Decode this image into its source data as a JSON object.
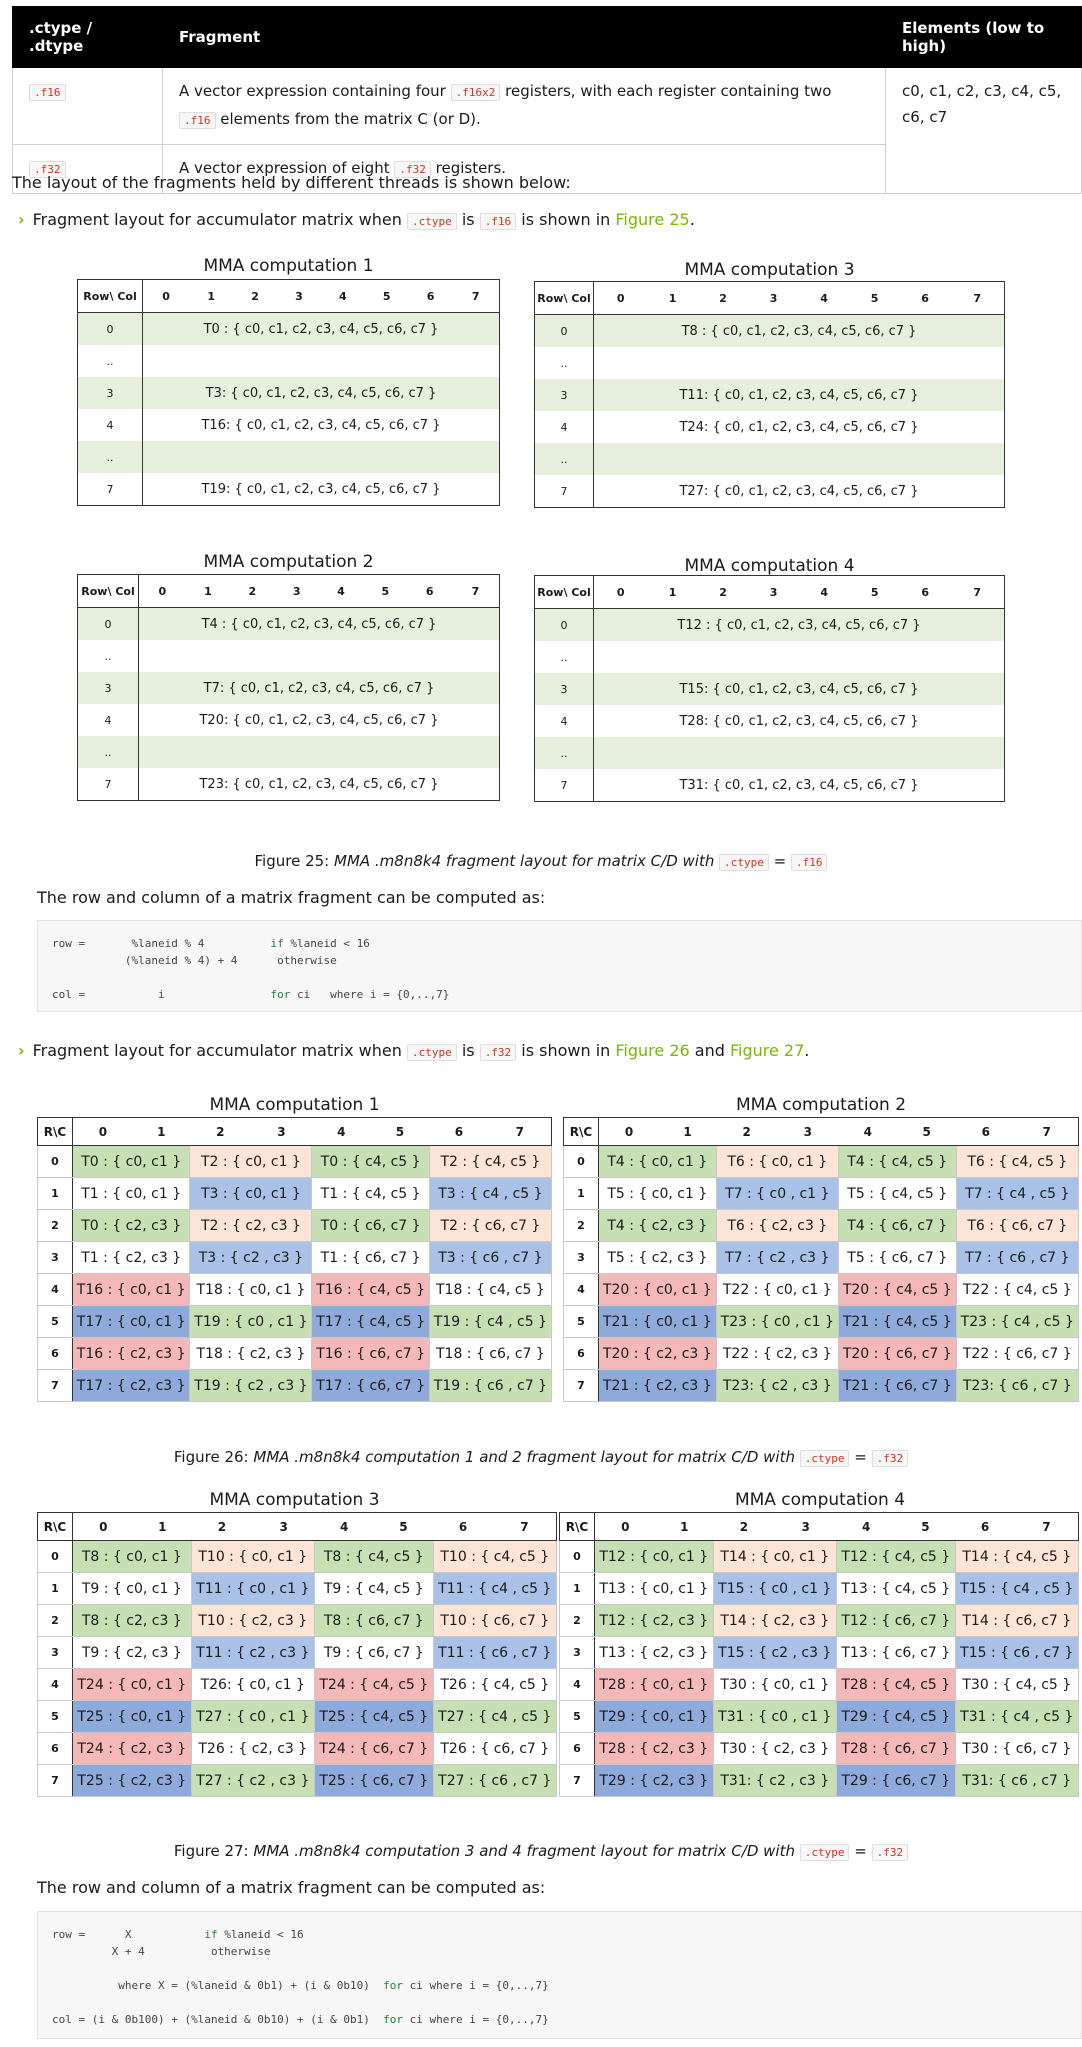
{
  "ctype_table": {
    "headers": [
      ".ctype / .dtype",
      "Fragment",
      "Elements (low to high)"
    ],
    "row1": {
      "type": ".f16",
      "desc_a": "A vector expression containing four ",
      "desc_code": ".f16x2",
      "desc_b": " registers, with each register containing two ",
      "desc_code2": ".f16",
      "desc_c": " elements from the matrix C (or D).",
      "elements": "c0, c1, c2, c3, c4, c5, c6, c7"
    },
    "row2": {
      "type": ".f32",
      "desc_a": "A vector expression of eight ",
      "desc_code": ".f32",
      "desc_b": " registers."
    }
  },
  "intro_text": "The layout of the fragments held by different threads is shown below:",
  "bullet1": {
    "a": "Fragment layout for accumulator matrix when ",
    "code1": ".ctype",
    "b": " is ",
    "code2": ".f16",
    "c": " is shown in ",
    "link1": "Figure 25",
    "d": "."
  },
  "mma_small": {
    "cols": [
      "Row\\ Col",
      "0",
      "1",
      "2",
      "3",
      "4",
      "5",
      "6",
      "7"
    ],
    "comp1": {
      "title": "MMA computation 1",
      "rows": [
        [
          "0",
          "T0 : { c0, c1, c2, c3, c4, c5, c6, c7 }"
        ],
        [
          "..",
          ""
        ],
        [
          "3",
          "T3: { c0, c1, c2, c3, c4, c5, c6, c7 }"
        ],
        [
          "4",
          "T16: { c0, c1, c2, c3, c4, c5, c6, c7 }"
        ],
        [
          "..",
          ""
        ],
        [
          "7",
          "T19: { c0, c1, c2, c3, c4, c5, c6, c7 }"
        ]
      ]
    },
    "comp2": {
      "title": "MMA computation 2",
      "rows": [
        [
          "0",
          "T4 : { c0, c1, c2, c3, c4, c5, c6, c7 }"
        ],
        [
          "..",
          ""
        ],
        [
          "3",
          "T7: { c0, c1, c2, c3, c4, c5, c6, c7 }"
        ],
        [
          "4",
          "T20: { c0, c1, c2, c3, c4, c5, c6, c7 }"
        ],
        [
          "..",
          ""
        ],
        [
          "7",
          "T23: { c0, c1, c2, c3, c4, c5, c6, c7 }"
        ]
      ]
    },
    "comp3": {
      "title": "MMA computation 3",
      "rows": [
        [
          "0",
          "T8 : { c0, c1, c2, c3, c4, c5, c6, c7 }"
        ],
        [
          "..",
          ""
        ],
        [
          "3",
          "T11: { c0, c1, c2, c3, c4, c5, c6, c7 }"
        ],
        [
          "4",
          "T24: { c0, c1, c2, c3, c4, c5, c6, c7 }"
        ],
        [
          "..",
          ""
        ],
        [
          "7",
          "T27: { c0, c1, c2, c3, c4, c5, c6, c7 }"
        ]
      ]
    },
    "comp4": {
      "title": "MMA computation 4",
      "rows": [
        [
          "0",
          "T12 : { c0, c1, c2, c3, c4, c5, c6, c7 }"
        ],
        [
          "..",
          ""
        ],
        [
          "3",
          "T15: { c0, c1, c2, c3, c4, c5, c6, c7 }"
        ],
        [
          "4",
          "T28: { c0, c1, c2, c3, c4, c5, c6, c7 }"
        ],
        [
          "..",
          ""
        ],
        [
          "7",
          "T31: { c0, c1, c2, c3, c4, c5, c6, c7 }"
        ]
      ]
    }
  },
  "fig25": {
    "a": "Figure 25: ",
    "b": "MMA .m8n8k4 fragment layout for matrix C/D with ",
    "code1": ".ctype",
    "eq": " = ",
    "code2": ".f16"
  },
  "rowcol_text1": "The row and column of a matrix fragment can be computed as:",
  "code1": {
    "l1a": "row =       %laneid % 4          ",
    "l1kw": "if",
    "l1b": " %laneid < 16",
    "l2": "           (%laneid % 4) + 4      otherwise",
    "l3a": "col =           i                ",
    "l3kw": "for",
    "l3b": " ci   where i = {0,..,7}"
  },
  "bullet2": {
    "a": "Fragment layout for accumulator matrix when ",
    "code1": ".ctype",
    "b": " is ",
    "code2": ".f32",
    "c": " is shown in ",
    "link1": "Figure 26",
    "d": " and ",
    "link2": "Figure 27",
    "e": "."
  },
  "mma_big": {
    "cols": [
      "R\\C",
      "0",
      "1",
      "2",
      "3",
      "4",
      "5",
      "6",
      "7"
    ],
    "comp1": {
      "title": "MMA computation 1",
      "rows": [
        [
          "0",
          "T0 : { c0, c1 }",
          "T2 : { c0, c1 }",
          "T0 : { c4, c5 }",
          "T2 : { c4, c5 }"
        ],
        [
          "1",
          "T1 : { c0, c1 }",
          "T3 : { c0, c1 }",
          "T1 : { c4, c5 }",
          "T3 : { c4 , c5 }"
        ],
        [
          "2",
          "T0 : { c2, c3 }",
          "T2 : { c2, c3 }",
          "T0 : { c6, c7 }",
          "T2 : { c6, c7 }"
        ],
        [
          "3",
          "T1 : { c2, c3 }",
          "T3 : { c2 , c3 }",
          "T1 : { c6, c7 }",
          "T3 : { c6 , c7 }"
        ],
        [
          "4",
          "T16 : { c0, c1 }",
          "T18 : { c0, c1 }",
          "T16 : { c4, c5 }",
          "T18 : { c4, c5 }"
        ],
        [
          "5",
          "T17 : { c0, c1 }",
          "T19 : { c0 , c1 }",
          "T17 : { c4, c5 }",
          "T19 : { c4 , c5 }"
        ],
        [
          "6",
          "T16 : { c2, c3 }",
          "T18 : { c2, c3 }",
          "T16 : { c6, c7 }",
          "T18 : { c6, c7 }"
        ],
        [
          "7",
          "T17 : { c2, c3 }",
          "T19 : { c2 , c3 }",
          "T17 : { c6, c7 }",
          "T19 : { c6 , c7 }"
        ]
      ]
    },
    "comp2": {
      "title": "MMA computation 2",
      "rows": [
        [
          "0",
          "T4 : { c0, c1 }",
          "T6 : { c0, c1 }",
          "T4 : { c4, c5 }",
          "T6 : { c4, c5 }"
        ],
        [
          "1",
          "T5 : { c0, c1 }",
          "T7 : { c0 , c1 }",
          "T5 : { c4, c5 }",
          "T7 : { c4 , c5 }"
        ],
        [
          "2",
          "T4 : { c2, c3 }",
          "T6 : { c2, c3 }",
          "T4 : { c6, c7 }",
          "T6 : { c6, c7 }"
        ],
        [
          "3",
          "T5 : { c2, c3 }",
          "T7 : { c2 , c3 }",
          "T5 : { c6, c7 }",
          "T7 : { c6 , c7 }"
        ],
        [
          "4",
          "T20 : { c0, c1 }",
          "T22 : { c0, c1 }",
          "T20 : { c4, c5 }",
          "T22 : { c4, c5 }"
        ],
        [
          "5",
          "T21 : { c0, c1 }",
          "T23 : { c0 , c1 }",
          "T21 : { c4, c5 }",
          "T23 : { c4 , c5 }"
        ],
        [
          "6",
          "T20 : { c2, c3 }",
          "T22 : { c2, c3 }",
          "T20 : { c6, c7 }",
          "T22 : { c6, c7 }"
        ],
        [
          "7",
          "T21 : { c2, c3 }",
          "T23: { c2 , c3 }",
          "T21 : { c6, c7 }",
          "T23: { c6 , c7 }"
        ]
      ]
    },
    "comp3": {
      "title": "MMA computation 3",
      "rows": [
        [
          "0",
          "T8 : { c0, c1 }",
          "T10 : { c0, c1 }",
          "T8 : { c4, c5 }",
          "T10 : { c4, c5 }"
        ],
        [
          "1",
          "T9 : { c0, c1 }",
          "T11 : { c0 , c1 }",
          "T9 : { c4, c5 }",
          "T11 : { c4 , c5 }"
        ],
        [
          "2",
          "T8 : { c2, c3 }",
          "T10 : { c2, c3 }",
          "T8 : { c6, c7 }",
          "T10 : { c6, c7 }"
        ],
        [
          "3",
          "T9 : { c2, c3 }",
          "T11 : { c2 , c3 }",
          "T9 : { c6, c7 }",
          "T11 : { c6 , c7 }"
        ],
        [
          "4",
          "T24 : { c0, c1 }",
          "T26: { c0, c1 }",
          "T24 : { c4, c5 }",
          "T26 : { c4, c5 }"
        ],
        [
          "5",
          "T25 : { c0, c1 }",
          "T27 : { c0 , c1 }",
          "T25 : { c4, c5 }",
          "T27 : { c4 , c5 }"
        ],
        [
          "6",
          "T24 : { c2, c3 }",
          "T26 : { c2, c3 }",
          "T24 : { c6, c7 }",
          "T26 : { c6, c7 }"
        ],
        [
          "7",
          "T25 : { c2, c3 }",
          "T27 : { c2 , c3 }",
          "T25 : { c6, c7 }",
          "T27 : { c6 , c7 }"
        ]
      ]
    },
    "comp4": {
      "title": "MMA computation 4",
      "rows": [
        [
          "0",
          "T12 : { c0, c1 }",
          "T14 : { c0, c1 }",
          "T12 : { c4, c5 }",
          "T14 : { c4, c5 }"
        ],
        [
          "1",
          "T13 : { c0, c1 }",
          "T15 : { c0 , c1 }",
          "T13 : { c4, c5 }",
          "T15 : { c4 , c5 }"
        ],
        [
          "2",
          "T12 : { c2, c3 }",
          "T14 : { c2, c3 }",
          "T12 : { c6, c7 }",
          "T14 : { c6, c7 }"
        ],
        [
          "3",
          "T13 : { c2, c3 }",
          "T15 : { c2 , c3 }",
          "T13 : { c6, c7 }",
          "T15 : { c6 , c7 }"
        ],
        [
          "4",
          "T28 : { c0, c1 }",
          "T30 : { c0, c1 }",
          "T28 : { c4, c5 }",
          "T30 : { c4, c5 }"
        ],
        [
          "5",
          "T29 : { c0, c1 }",
          "T31 : { c0 , c1 }",
          "T29 : { c4, c5 }",
          "T31 : { c4 , c5 }"
        ],
        [
          "6",
          "T28 : { c2, c3 }",
          "T30 : { c2, c3 }",
          "T28 : { c6, c7 }",
          "T30 : { c6, c7 }"
        ],
        [
          "7",
          "T29 : { c2, c3 }",
          "T31: { c2 , c3 }",
          "T29 : { c6, c7 }",
          "T31: { c6 , c7 }"
        ]
      ]
    }
  },
  "fig26": {
    "a": "Figure 26: ",
    "b": "MMA .m8n8k4 computation 1 and 2 fragment layout for matrix C/D with ",
    "code1": ".ctype",
    "eq": " = ",
    "code2": ".f32"
  },
  "fig27": {
    "a": "Figure 27: ",
    "b": "MMA .m8n8k4 computation 3 and 4 fragment layout for matrix C/D with ",
    "code1": ".ctype",
    "eq": " = ",
    "code2": ".f32"
  },
  "rowcol_text2": "The row and column of a matrix fragment can be computed as:",
  "code2": {
    "l1a": "row =      X           ",
    "l1kw": "if",
    "l1b": " %laneid < 16",
    "l2": "         X + 4          otherwise",
    "l3a": "          where X = (%laneid & 0b1) + (i & 0b10)  ",
    "l3kw": "for",
    "l3b": " ci where i = {0,..,7}",
    "l4a": "col = (i & 0b100) + (%laneid & 0b10) + (i & 0b1)  ",
    "l4kw": "for",
    "l4b": " ci where i = {0,..,7}"
  },
  "colors": {
    "green": "#c6e0b4",
    "peach": "#fce4d6",
    "blue": "#a9c1e6",
    "red": "#f4b8b8",
    "dark_blue": "#8eaadb",
    "light_green": "#e5efdc",
    "link": "#76b900"
  }
}
